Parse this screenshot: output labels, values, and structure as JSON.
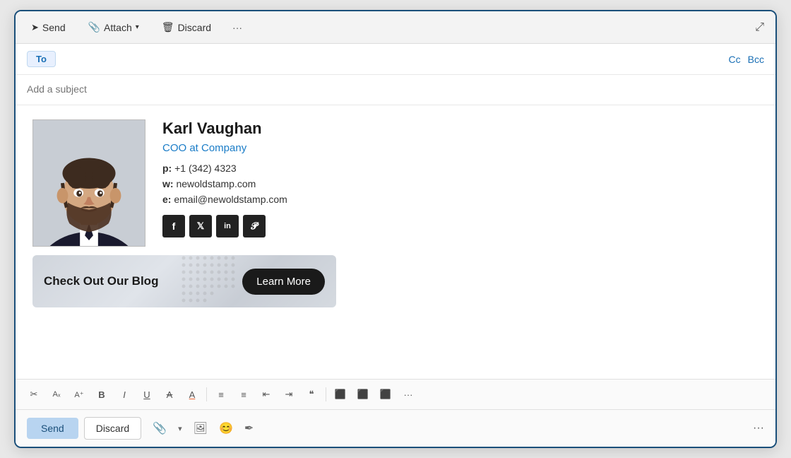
{
  "toolbar": {
    "send_label": "Send",
    "attach_label": "Attach",
    "discard_label": "Discard",
    "more_label": "···",
    "send_icon": "▷",
    "attach_icon": "📎",
    "discard_icon": "🗑",
    "expand_icon": "⤢"
  },
  "to_field": {
    "label": "To",
    "cc_label": "Cc",
    "bcc_label": "Bcc"
  },
  "subject": {
    "placeholder": "Add a subject"
  },
  "signature": {
    "name": "Karl Vaughan",
    "title": "COO at Company",
    "phone_label": "p:",
    "phone": "+1 (342) 4323",
    "web_label": "w:",
    "web": "newoldstamp.com",
    "email_label": "e:",
    "email": "email@newoldstamp.com",
    "socials": [
      "f",
      "t",
      "in",
      "p"
    ]
  },
  "banner": {
    "text": "Check Out Our Blog",
    "button_label": "Learn More"
  },
  "format_toolbar": {
    "buttons": [
      "✂",
      "Aₓ",
      "A",
      "B",
      "I",
      "U",
      "A̲",
      "A",
      "≡",
      "≡",
      "←",
      "→",
      "❝",
      "≡",
      "≡",
      "≡",
      "···"
    ]
  },
  "action_bar": {
    "send_label": "Send",
    "discard_label": "Discard"
  }
}
